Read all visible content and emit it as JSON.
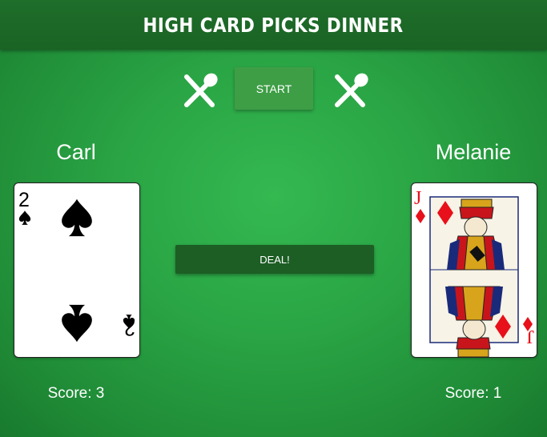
{
  "header": {
    "title": "HIGH CARD PICKS DINNER"
  },
  "controls": {
    "start_label": "START",
    "deal_label": "DEAL!"
  },
  "players": [
    {
      "name": "Carl",
      "score_text": "Score: 3",
      "card": {
        "rank": "2",
        "suit": "spades",
        "color": "#000000"
      }
    },
    {
      "name": "Melanie",
      "score_text": "Score: 1",
      "card": {
        "rank": "J",
        "suit": "diamonds",
        "color": "#e8101a"
      }
    }
  ],
  "icons": {
    "utensils": "fork-and-spoon-crossed-icon"
  },
  "colors": {
    "table": "#2aa545",
    "header": "#1c6626",
    "start_button": "#3e9e46",
    "deal_button": "#1c5e24"
  }
}
